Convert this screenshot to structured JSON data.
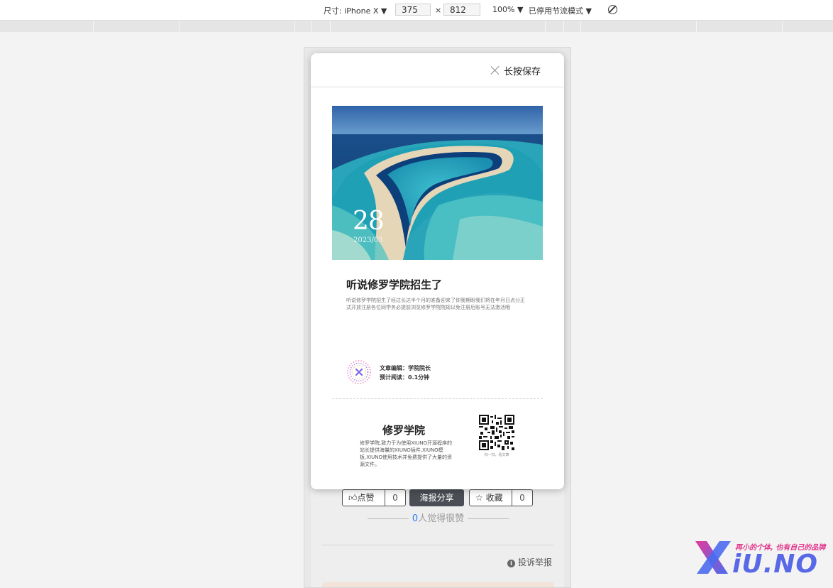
{
  "devtools": {
    "device_label": "尺寸: iPhone X",
    "width": "375",
    "times": "×",
    "height": "812",
    "zoom": "100%",
    "throttle": "已停用节流模式",
    "dropdown_arrow": "▼",
    "rotate_icon": "rotate-icon"
  },
  "page": {
    "like_label": "点赞",
    "like_count": "0",
    "poster_share": "海报分享",
    "favorite_label": "收藏",
    "favorite_count": "0",
    "liked_count": "0",
    "liked_text": "人觉得很赞",
    "report": "投诉举报"
  },
  "modal": {
    "save_label": "长按保存",
    "hero_day": "28",
    "hero_yearmonth": "2023/03",
    "title": "听说修罗学院招生了",
    "excerpt": "听说修罗学院招生了经过长达半个月的准备迎来了你我期盼我们将在年月日点分正式开放注册各位同学务必提前浏览修罗学院院规以免注册后账号无法激活哦",
    "author_line": "文章编辑：学院院长",
    "read_time": "预计阅读：0.1分钟",
    "brand_name": "修罗学院",
    "brand_desc": "修罗学院,致力于为使用XIUNO开源程序的站长提供海量的XIUNO插件,XIUNO模板,XIUNO使用技术并免费提供了大量的资源文件。",
    "qr_caption": "扫一扫，看文章"
  },
  "watermark": {
    "slogan": "再小的个体, 也有自己的品牌",
    "text": "iU.NO",
    "accent": "#5868e6",
    "slogan_color": "#e3358c"
  }
}
